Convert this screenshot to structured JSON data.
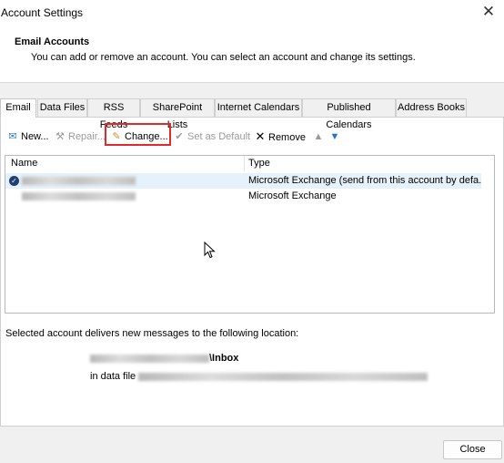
{
  "window": {
    "title": "Account Settings",
    "close_glyph": "✕"
  },
  "header": {
    "title": "Email Accounts",
    "subtitle": "You can add or remove an account. You can select an account and change its settings."
  },
  "tabs": [
    {
      "label": "Email",
      "active": true
    },
    {
      "label": "Data Files"
    },
    {
      "label": "RSS Feeds"
    },
    {
      "label": "SharePoint Lists"
    },
    {
      "label": "Internet Calendars"
    },
    {
      "label": "Published Calendars"
    },
    {
      "label": "Address Books"
    }
  ],
  "toolbar": {
    "new_label": "New...",
    "repair_label": "Repair...",
    "change_label": "Change...",
    "set_default_label": "Set as Default",
    "remove_label": "Remove",
    "highlight_color": "#e02b2b"
  },
  "accounts_list": {
    "columns": [
      "Name",
      "Type"
    ],
    "rows": [
      {
        "type": "Microsoft Exchange (send from this account by defa...",
        "is_default": true,
        "selected": true
      },
      {
        "type": "Microsoft Exchange"
      }
    ]
  },
  "delivery": {
    "message": "Selected account delivers new messages to the following location:",
    "folder_suffix": "\\Inbox",
    "data_file_prefix": "in data file"
  },
  "footer": {
    "close_label": "Close"
  }
}
